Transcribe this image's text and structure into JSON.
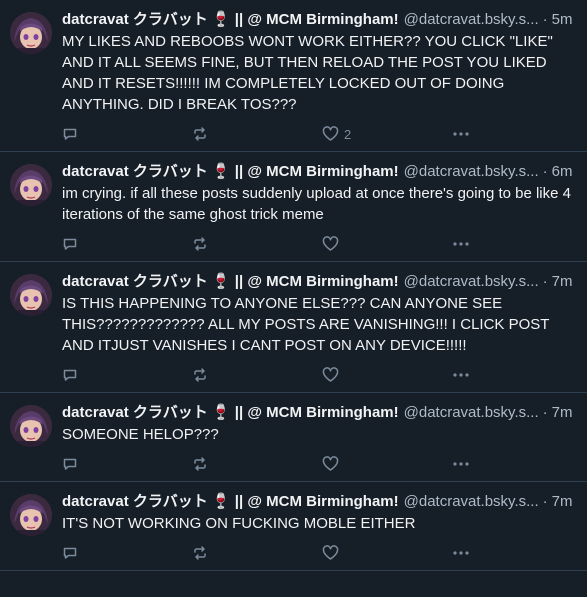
{
  "author": {
    "name": "datcravat クラバット",
    "wine_emoji": "🍷",
    "name_suffix": "|| @ MCM Birmingham!",
    "handle": "@datcravat.bsky.s..."
  },
  "colors": {
    "background": "#161e27",
    "divider": "#2e4052",
    "text": "#f1f3f5",
    "muted": "#aebbc9",
    "icon": "#7b8b9c"
  },
  "posts": [
    {
      "time": "5m",
      "text": "MY LIKES AND REBOOBS WONT WORK EITHER?? YOU CLICK \"LIKE\" AND IT ALL SEEMS FINE, BUT THEN RELOAD THE POST YOU LIKED AND IT RESETS!!!!!! IM COMPLETELY LOCKED OUT OF DOING ANYTHING. DID I BREAK TOS???",
      "like_count": "2"
    },
    {
      "time": "6m",
      "text": "im crying. if all these posts suddenly upload at once there's going to be like 4 iterations of the same ghost trick meme",
      "like_count": ""
    },
    {
      "time": "7m",
      "text": "IS THIS HAPPENING TO ANYONE ELSE??? CAN ANYONE SEE THIS????????????? ALL MY POSTS ARE VANISHING!!! I CLICK POST AND ITJUST VANISHES I CANT POST ON ANY DEVICE!!!!!",
      "like_count": ""
    },
    {
      "time": "7m",
      "text": "SOMEONE HELOP???",
      "like_count": ""
    },
    {
      "time": "7m",
      "text": "IT'S NOT WORKING ON FUCKING MOBLE EITHER",
      "like_count": ""
    }
  ],
  "icons": {
    "reply": "reply-bubble-icon",
    "repost": "repost-arrows-icon",
    "like": "heart-icon",
    "more": "more-dots-icon"
  }
}
